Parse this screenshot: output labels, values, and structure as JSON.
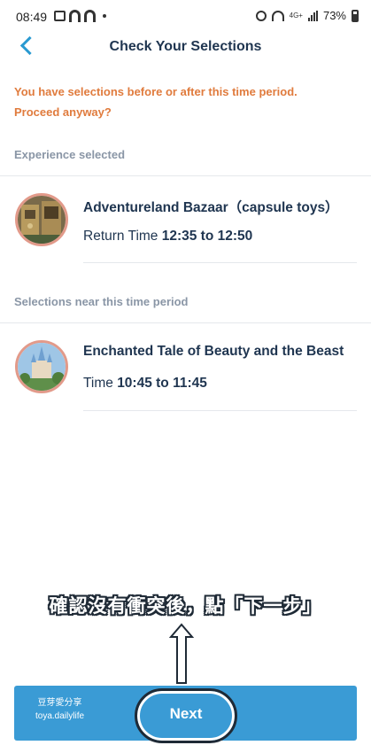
{
  "status_bar": {
    "time": "08:49",
    "network": "4G+",
    "battery": "73%"
  },
  "header": {
    "title": "Check Your Selections",
    "back_icon": "chevron-left-icon"
  },
  "warning": "You have selections before or after this time period. Proceed anyway?",
  "experience_section": {
    "label": "Experience selected",
    "item": {
      "title": "Adventureland Bazaar（capsule toys）",
      "time_label": "Return Time",
      "time_value": "12:35 to 12:50"
    }
  },
  "nearby_section": {
    "label": "Selections near this time period",
    "item": {
      "title": "Enchanted Tale of Beauty and the Beast",
      "time_label": "Time",
      "time_value": "10:45 to 11:45"
    }
  },
  "annotation": "確認沒有衝突後，點「下一步」",
  "watermark": {
    "line1": "豆芽愛分享",
    "line2": "toya.dailylife"
  },
  "footer": {
    "next_label": "Next"
  },
  "colors": {
    "accent": "#3a9bd5",
    "warning": "#e07b3d",
    "title": "#1f3550",
    "muted": "#8a96a6",
    "thumb_ring": "#e29a8a"
  }
}
